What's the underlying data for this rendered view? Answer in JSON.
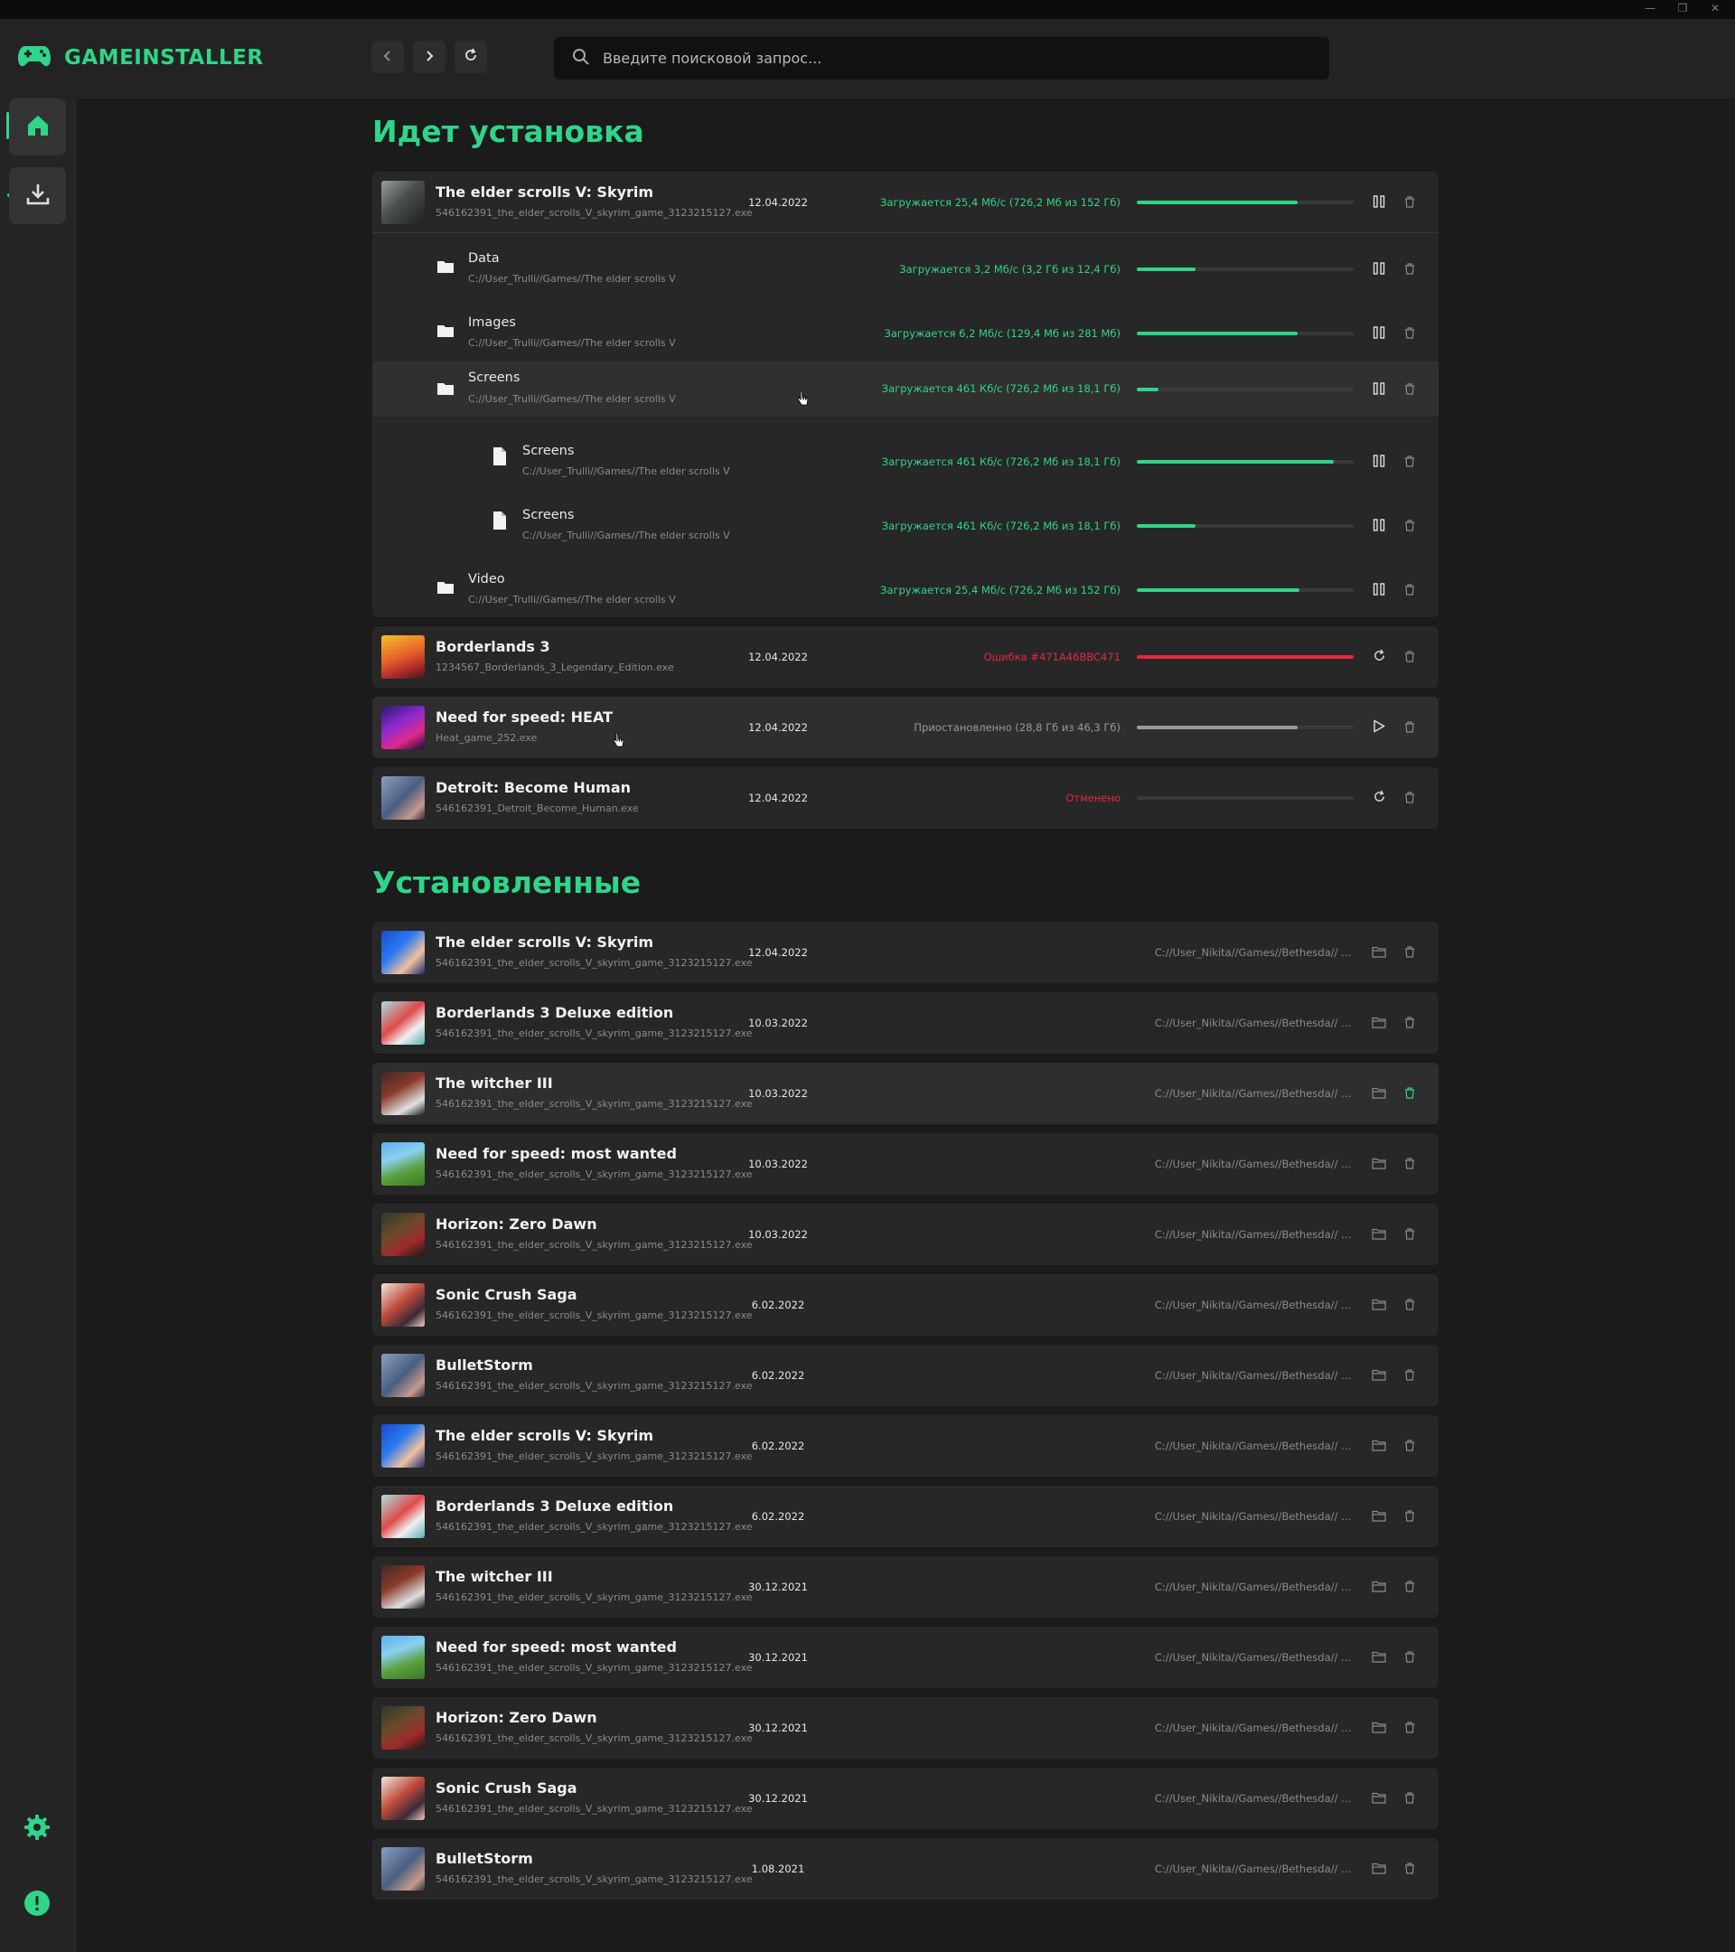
{
  "app": {
    "name": "GAMEINSTALLER",
    "window_controls": [
      "—",
      "❐",
      "✕"
    ]
  },
  "search": {
    "placeholder": "Введите поисковой запрос..."
  },
  "sections": {
    "installing_title": "Идет установка",
    "installed_title": "Установленные"
  },
  "installing": {
    "skyrim": {
      "name": "The elder scrolls V: Skyrim",
      "file": "546162391_the_elder_scrolls_V_skyrim_game_3123215127.exe",
      "date": "12.04.2022",
      "status": "Загружается 25,4 Мб/с (726,2 Мб из 152 Гб)",
      "progress": 0.74,
      "children": [
        {
          "kind": "folder",
          "name": "Data",
          "path": "C://User_Trulli//Games//The elder scrolls V",
          "status": "Загружается 3,2 Мб/с (3,2 Гб из 12,4 Гб)",
          "progress": 0.27,
          "depth": 1
        },
        {
          "kind": "folder",
          "name": "Images",
          "path": "C://User_Trulli//Games//The elder scrolls V",
          "status": "Загружается 6,2 Мб/с (129,4 Мб из 281 Мб)",
          "progress": 0.74,
          "depth": 1
        },
        {
          "kind": "folder",
          "name": "Screens",
          "path": "C://User_Trulli//Games//The elder scrolls V",
          "status": "Загружается 461 Кб/с (726,2 Мб из 18,1 Гб)",
          "progress": 0.1,
          "depth": 1
        },
        {
          "kind": "file",
          "name": "Screens",
          "path": "C://User_Trulli//Games//The elder scrolls V",
          "status": "Загружается 461 Кб/с (726,2 Мб из 18,1 Гб)",
          "progress": 0.91,
          "depth": 2
        },
        {
          "kind": "file",
          "name": "Screens",
          "path": "C://User_Trulli//Games//The elder scrolls V",
          "status": "Загружается 461 Кб/с (726,2 Мб из 18,1 Гб)",
          "progress": 0.27,
          "depth": 2
        },
        {
          "kind": "folder",
          "name": "Video",
          "path": "C://User_Trulli//Games//The elder scrolls V",
          "status": "Загружается 25,4 Мб/с (726,2 Мб из 152 Гб)",
          "progress": 0.75,
          "depth": 1
        }
      ]
    },
    "others": [
      {
        "name": "Borderlands 3",
        "file": "1234567_Borderlands_3_Legendary_Edition.exe",
        "date": "12.04.2022",
        "status": "Ошибка #471A46BBC471",
        "status_type": "error",
        "progress": 1.0,
        "action": "retry"
      },
      {
        "name": "Need for speed: HEAT",
        "file": "Heat_game_252.exe",
        "date": "12.04.2022",
        "status": "Приостановленно (28,8 Гб из 46,3 Гб)",
        "status_type": "paused",
        "progress": 0.74,
        "action": "play"
      },
      {
        "name": "Detroit: Become Human",
        "file": "546162391_Detroit_Become_Human.exe",
        "date": "12.04.2022",
        "status": "Отменено",
        "status_type": "cancelled",
        "progress": 0,
        "action": "retry"
      }
    ]
  },
  "installed": [
    {
      "name": "The elder scrolls V: Skyrim",
      "file": "546162391_the_elder_scrolls_V_skyrim_game_3123215127.exe",
      "date": "12.04.2022",
      "path": "C://User_Nikita//Games//Bethesda// ...",
      "thumb": "sonic"
    },
    {
      "name": "Borderlands 3 Deluxe edition",
      "file": "546162391_the_elder_scrolls_V_skyrim_game_3123215127.exe",
      "date": "10.03.2022",
      "path": "C://User_Nikita//Games//Bethesda// ...",
      "thumb": "crab"
    },
    {
      "name": "The witcher III",
      "file": "546162391_the_elder_scrolls_V_skyrim_game_3123215127.exe",
      "date": "10.03.2022",
      "path": "C://User_Nikita//Games//Bethesda// ...",
      "thumb": "league"
    },
    {
      "name": "Need for speed: most wanted",
      "file": "546162391_the_elder_scrolls_V_skyrim_game_3123215127.exe",
      "date": "10.03.2022",
      "path": "C://User_Nikita//Games//Bethesda// ...",
      "thumb": "minecraft"
    },
    {
      "name": "Horizon: Zero Dawn",
      "file": "546162391_the_elder_scrolls_V_skyrim_game_3123215127.exe",
      "date": "10.03.2022",
      "path": "C://User_Nikita//Games//Bethesda// ...",
      "thumb": "war"
    },
    {
      "name": "Sonic Crush Saga",
      "file": "546162391_the_elder_scrolls_V_skyrim_game_3123215127.exe",
      "date": "6.02.2022",
      "path": "C://User_Nikita//Games//Bethesda// ...",
      "thumb": "anime"
    },
    {
      "name": "BulletStorm",
      "file": "546162391_the_elder_scrolls_V_skyrim_game_3123215127.exe",
      "date": "6.02.2022",
      "path": "C://User_Nikita//Games//Bethesda// ...",
      "thumb": "detroit"
    },
    {
      "name": "The elder scrolls V: Skyrim",
      "file": "546162391_the_elder_scrolls_V_skyrim_game_3123215127.exe",
      "date": "6.02.2022",
      "path": "C://User_Nikita//Games//Bethesda// ...",
      "thumb": "sonic"
    },
    {
      "name": "Borderlands 3 Deluxe edition",
      "file": "546162391_the_elder_scrolls_V_skyrim_game_3123215127.exe",
      "date": "6.02.2022",
      "path": "C://User_Nikita//Games//Bethesda// ...",
      "thumb": "crab"
    },
    {
      "name": "The witcher III",
      "file": "546162391_the_elder_scrolls_V_skyrim_game_3123215127.exe",
      "date": "30.12.2021",
      "path": "C://User_Nikita//Games//Bethesda// ...",
      "thumb": "league"
    },
    {
      "name": "Need for speed: most wanted",
      "file": "546162391_the_elder_scrolls_V_skyrim_game_3123215127.exe",
      "date": "30.12.2021",
      "path": "C://User_Nikita//Games//Bethesda// ...",
      "thumb": "minecraft"
    },
    {
      "name": "Horizon: Zero Dawn",
      "file": "546162391_the_elder_scrolls_V_skyrim_game_3123215127.exe",
      "date": "30.12.2021",
      "path": "C://User_Nikita//Games//Bethesda// ...",
      "thumb": "war"
    },
    {
      "name": "Sonic Crush Saga",
      "file": "546162391_the_elder_scrolls_V_skyrim_game_3123215127.exe",
      "date": "30.12.2021",
      "path": "C://User_Nikita//Games//Bethesda// ...",
      "thumb": "anime"
    },
    {
      "name": "BulletStorm",
      "file": "546162391_the_elder_scrolls_V_skyrim_game_3123215127.exe",
      "date": "1.08.2021",
      "path": "C://User_Nikita//Games//Bethesda// ...",
      "thumb": "detroit"
    }
  ],
  "colors": {
    "accent": "#2fd589",
    "error": "#e22844",
    "paused": "#9a9a9a",
    "bg": "#1b1b1b",
    "card": "#272727"
  },
  "icons": {
    "logo": "gamepad-icon",
    "back": "chevron-left-icon",
    "forward": "chevron-right-icon",
    "refresh": "refresh-icon",
    "search": "search-icon",
    "home": "home-icon",
    "downloads": "download-icon",
    "settings": "gear-icon",
    "info": "info-icon",
    "pause": "pause-icon",
    "delete": "trash-icon",
    "folder": "folder-icon",
    "file": "file-icon",
    "retry": "retry-icon",
    "play": "play-icon",
    "open-folder": "open-folder-icon"
  }
}
